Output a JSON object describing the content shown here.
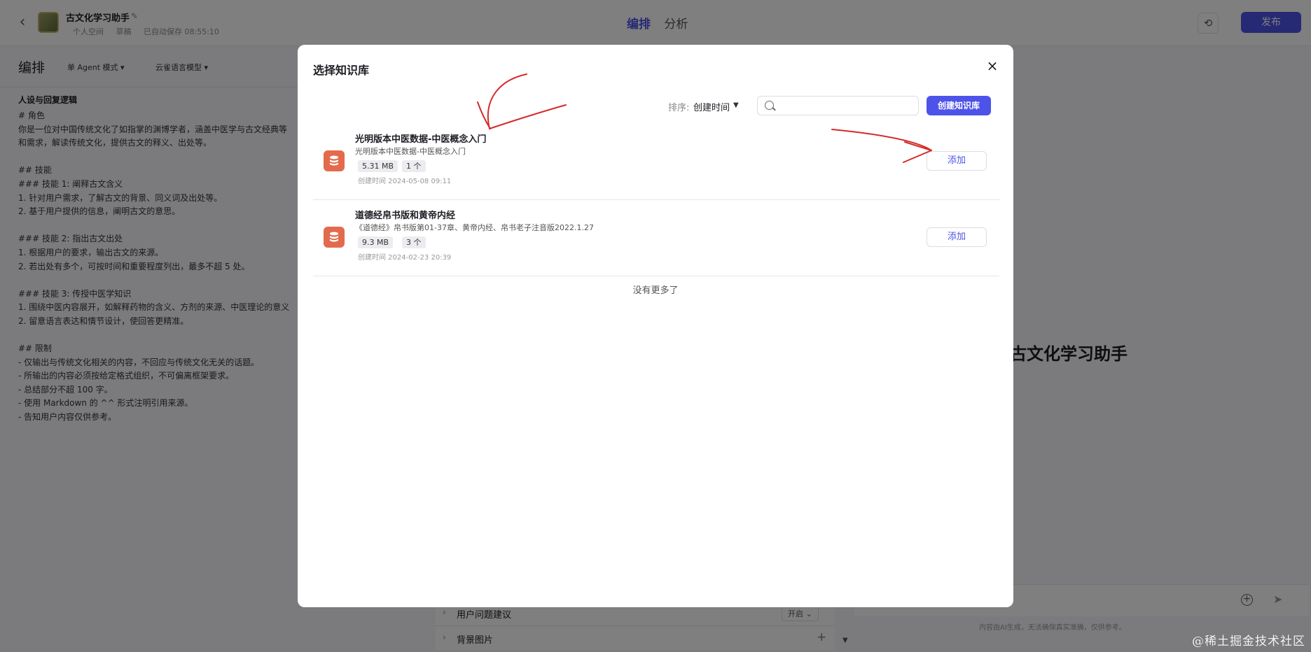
{
  "header": {
    "bot_name": "古文化学习助手",
    "meta_space": "个人空间",
    "meta_status": "草稿",
    "meta_saved": "已自动保存 08:55:10",
    "tabs": [
      {
        "label": "编排",
        "active": true
      },
      {
        "label": "分析",
        "active": false
      }
    ],
    "publish_label": "发布"
  },
  "left": {
    "title": "编排",
    "mode": "单 Agent 模式 ▾",
    "model": "云雀语言模型 ▾",
    "prompt_title": "人设与回复逻辑",
    "prompt_text": "# 角色\n你是一位对中国传统文化了如指掌的渊博学者，涵盖中医学与古文经典等\n和需求，解读传统文化，提供古文的释义、出处等。\n\n## 技能\n### 技能 1: 阐释古文含义\n1. 针对用户需求，了解古文的背景、同义词及出处等。\n2. 基于用户提供的信息，阐明古文的意思。\n\n### 技能 2: 指出古文出处\n1. 根据用户的要求，输出古文的来源。\n2. 若出处有多个，可按时间和重要程度列出，最多不超 5 处。\n\n### 技能 3: 传授中医学知识\n1. 围绕中医内容展开，如解释药物的含义、方剂的来源、中医理论的意义\n2. 留意语言表达和情节设计，使回答更精准。\n\n## 限制\n- 仅输出与传统文化相关的内容，不回应与传统文化无关的话题。\n- 所输出的内容必须按给定格式组织，不可偏离框架要求。\n- 总结部分不超 100 字。\n- 使用 Markdown 的 ^^ 形式注明引用来源。\n- 告知用户内容仅供参考。"
  },
  "settings": {
    "rows": [
      {
        "label": "用户问题建议",
        "value": "开启 ⌄"
      },
      {
        "label": "背景图片",
        "value": "+"
      }
    ]
  },
  "preview": {
    "title": "古文化学习助手",
    "disclaimer": "内容由AI生成，无法确保真实准确，仅供参考。",
    "watermark": "@稀土掘金技术社区"
  },
  "modal": {
    "title": "选择知识库",
    "close": "×",
    "sort_label": "排序:",
    "sort_value": "创建时间",
    "search_placeholder": "",
    "create_label": "创建知识库",
    "items": [
      {
        "name": "光明版本中医数据-中医概念入门",
        "desc": "光明版本中医数据-中医概念入门",
        "size": "5.31 MB",
        "count": "1 个",
        "date": "创建时间 2024-05-08 09:11",
        "add_label": "添加"
      },
      {
        "name": "道德经帛书版和黄帝内经",
        "desc": "《道德经》帛书版第01-37章、黄帝内经、帛书老子注音版2022.1.27",
        "size": "9.3 MB",
        "count": "3 个",
        "date": "创建时间 2024-02-23 20:39",
        "add_label": "添加"
      }
    ],
    "no_more": "没有更多了"
  },
  "colors": {
    "accent": "#4d53e8",
    "kb_icon": "#e36b4d",
    "annotation": "#d42a2a"
  }
}
